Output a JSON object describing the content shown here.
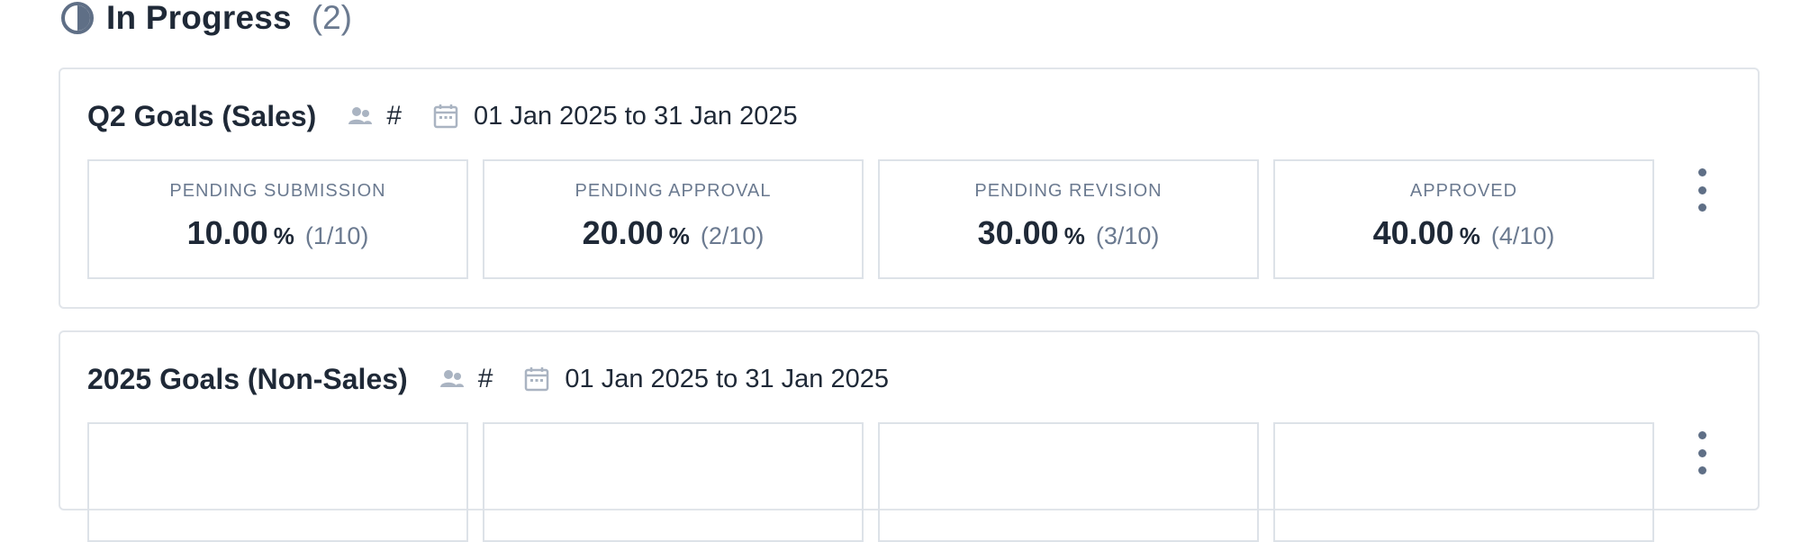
{
  "section": {
    "title": "In Progress",
    "count": "(2)",
    "icon": "pie-progress-icon"
  },
  "goals": [
    {
      "title": "Q2 Goals (Sales)",
      "hash": "#",
      "date_range": "01 Jan 2025 to 31 Jan 2025",
      "stats": [
        {
          "label": "PENDING SUBMISSION",
          "percent": "10.00",
          "percent_sign": "%",
          "fraction": "(1/10)"
        },
        {
          "label": "PENDING APPROVAL",
          "percent": "20.00",
          "percent_sign": "%",
          "fraction": "(2/10)"
        },
        {
          "label": "PENDING REVISION",
          "percent": "30.00",
          "percent_sign": "%",
          "fraction": "(3/10)"
        },
        {
          "label": "APPROVED",
          "percent": "40.00",
          "percent_sign": "%",
          "fraction": "(4/10)"
        }
      ]
    },
    {
      "title": "2025 Goals (Non-Sales)",
      "hash": "#",
      "date_range": "01 Jan 2025 to 31 Jan 2025"
    }
  ],
  "colors": {
    "text_primary": "#1f2937",
    "text_muted": "#6b7a90",
    "border": "#e1e5ea",
    "icon": "#5f6f86",
    "icon_light": "#aab4c2"
  }
}
